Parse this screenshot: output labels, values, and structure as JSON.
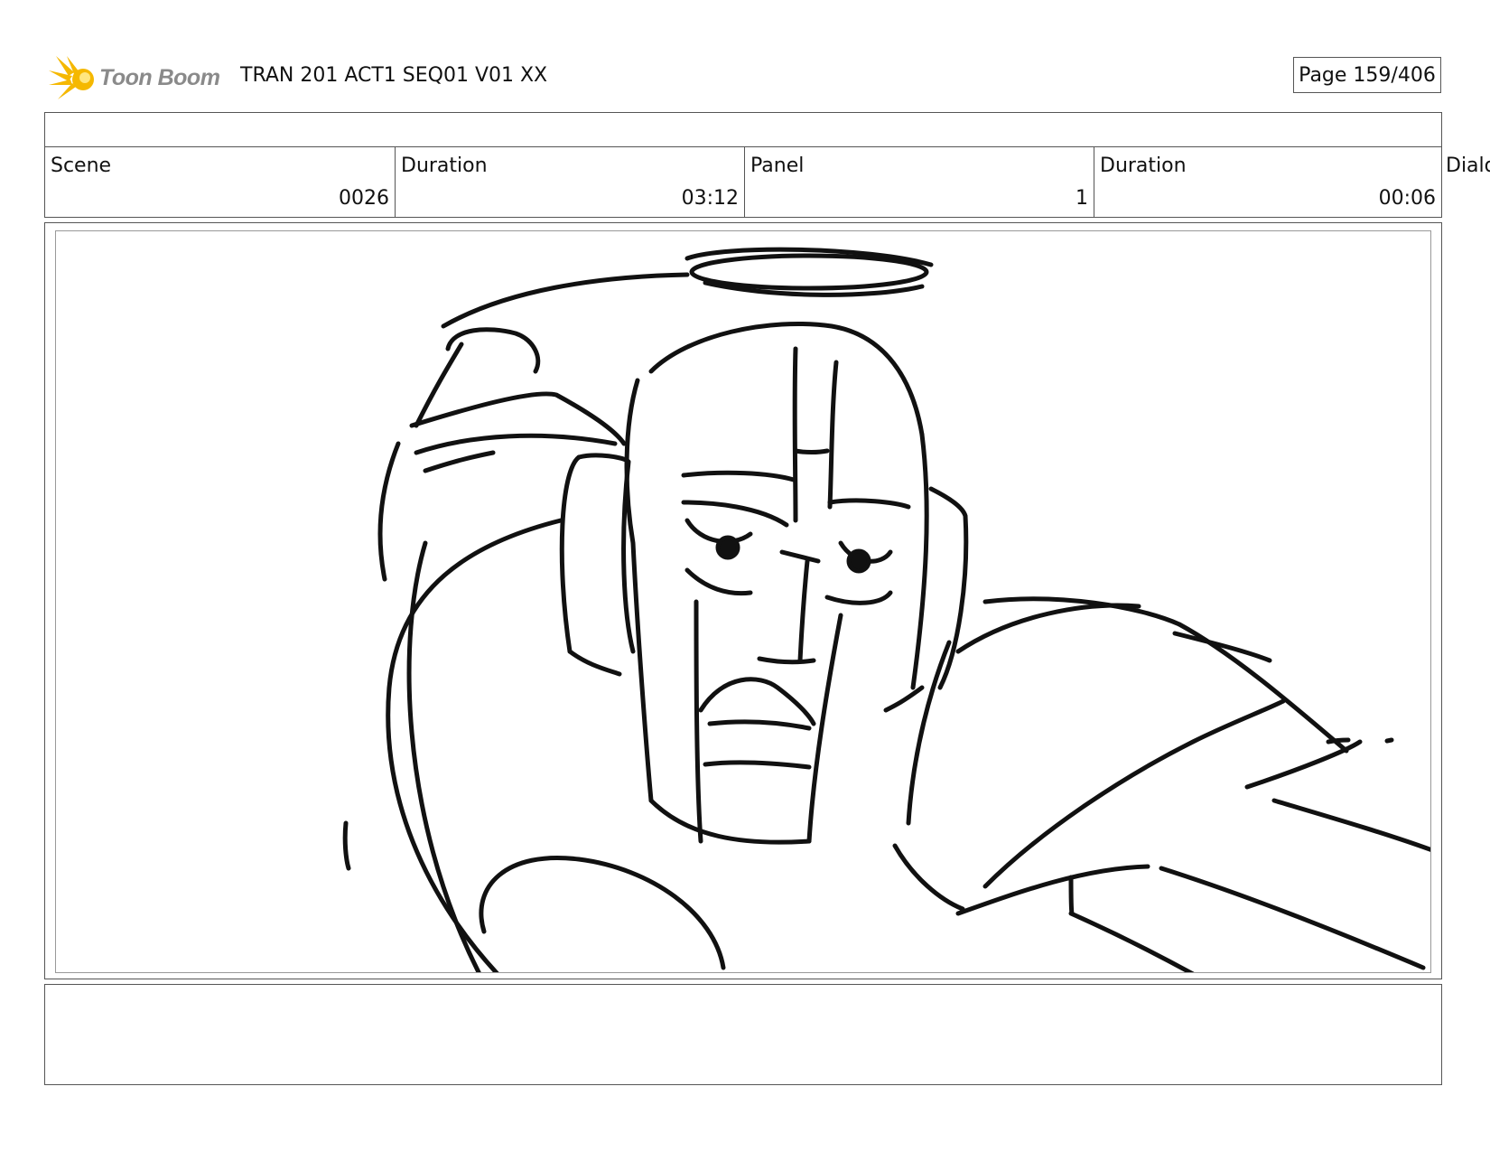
{
  "header": {
    "brand": "Toon Boom",
    "title": "TRAN 201 ACT1 SEQ01 V01 XX",
    "page": "Page 159/406"
  },
  "info": {
    "scene_label": "Scene",
    "scene_value": "0026",
    "scene_duration_label": "Duration",
    "scene_duration_value": "03:12",
    "panel_label": "Panel",
    "panel_value": "1",
    "panel_duration_label": "Duration",
    "panel_duration_value": "00:06",
    "dialogue_label": "Dialo"
  },
  "notes": "",
  "colors": {
    "logo_star": "#f5b800",
    "logo_text": "#8a8a8a",
    "border": "#555555"
  },
  "icons": {
    "logo": "toon-boom-star-icon"
  }
}
